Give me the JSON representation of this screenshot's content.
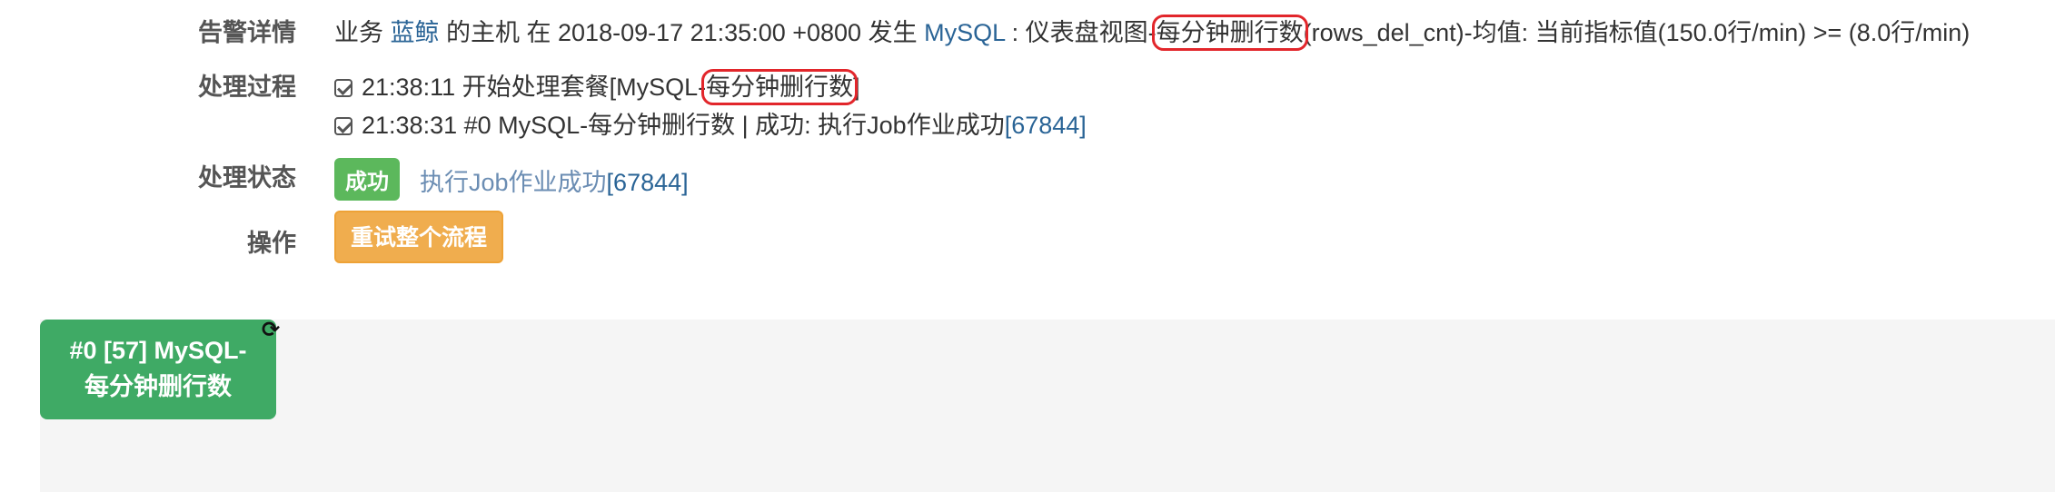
{
  "alert": {
    "label": "告警详情",
    "prefix": "业务 ",
    "business_link": "蓝鲸",
    "host_text": " 的主机 在 2018-09-17 21:35:00 +0800 发生 ",
    "mysql_link": "MySQL",
    "colon_text": " : 仪表盘视图-",
    "metric_highlight": "每分钟删行数",
    "suffix": "(rows_del_cnt)-均值: 当前指标值(150.0行/min) >= (8.0行/min)"
  },
  "process": {
    "label": "处理过程",
    "line1_prefix": "21:38:11 开始处理套餐[MySQL-",
    "line1_highlight": "每分钟删行数",
    "line1_suffix": "]",
    "line2_text": "21:38:31 #0 MySQL-每分钟删行数 | 成功: 执行Job作业成功",
    "line2_link": "[67844]"
  },
  "status": {
    "label": "处理状态",
    "badge": "成功",
    "text": "执行Job作业成功",
    "link": "[67844]"
  },
  "operation": {
    "label": "操作",
    "retry_button": "重试整个流程"
  },
  "flow": {
    "node_line1": "#0 [57] MySQL-",
    "node_line2": "每分钟删行数",
    "refresh_icon": "refresh-icon"
  },
  "colors": {
    "link": "#2a6496",
    "success": "#5cb85c",
    "warning": "#f0ad4e",
    "node": "#3faa65",
    "highlight": "#e2262b"
  }
}
